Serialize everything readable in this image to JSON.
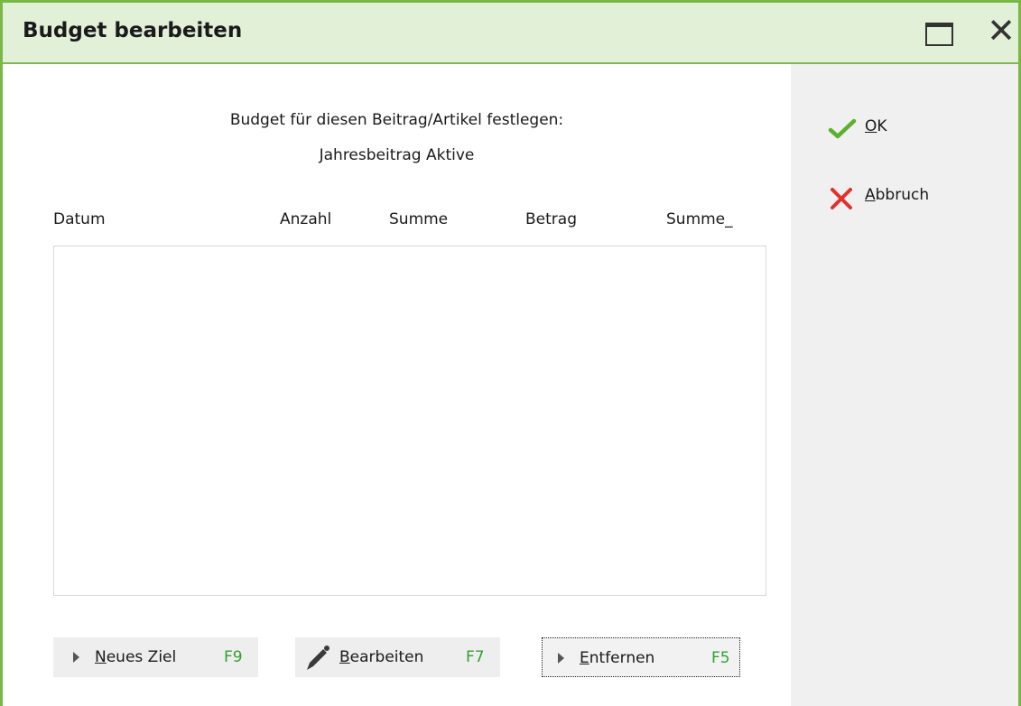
{
  "window": {
    "title": "Budget bearbeiten"
  },
  "main": {
    "heading": "Budget für diesen Beitrag/Artikel festlegen:",
    "subheading": "Jahresbeitrag Aktive",
    "columns": [
      "Datum",
      "Anzahl",
      "Summe",
      "Betrag",
      "Summe_"
    ],
    "rows": []
  },
  "buttons": {
    "new": {
      "mnemonic": "N",
      "rest": "eues Ziel",
      "key": "F9"
    },
    "edit": {
      "mnemonic": "B",
      "rest": "earbeiten",
      "key": "F7"
    },
    "remove": {
      "mnemonic": "E",
      "rest": "ntfernen",
      "key": "F5"
    }
  },
  "side": {
    "ok": {
      "mnemonic": "O",
      "rest": "K"
    },
    "cancel": {
      "mnemonic": "A",
      "rest": "bbruch"
    }
  },
  "colors": {
    "accent": "#78b845",
    "key": "#2ea32e",
    "ok": "#5bb02f",
    "cancel": "#e0312b"
  }
}
